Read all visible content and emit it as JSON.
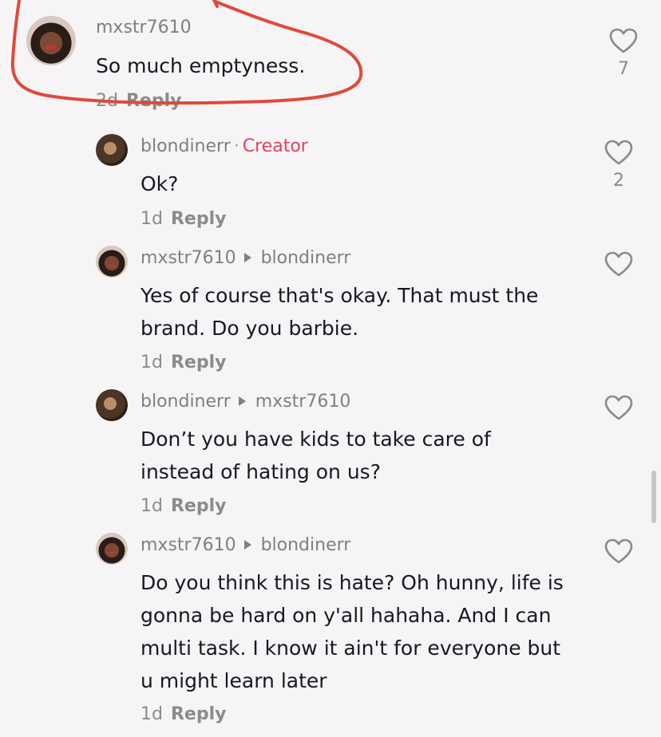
{
  "comments": [
    {
      "username": "mxstr7610",
      "text": "So much emptyness.",
      "age": "2d",
      "reply_label": "Reply",
      "likes": "7"
    },
    {
      "username": "blondinerr",
      "separator": "·",
      "badge": "Creator",
      "text": "Ok?",
      "age": "1d",
      "reply_label": "Reply",
      "likes": "2"
    },
    {
      "username": "mxstr7610",
      "reply_to": "blondinerr",
      "text_lines": [
        "Yes of course that's okay. That must the",
        "brand. Do you barbie."
      ],
      "age": "1d",
      "reply_label": "Reply"
    },
    {
      "username": "blondinerr",
      "reply_to": "mxstr7610",
      "text_lines": [
        "Don’t you have kids to take care of",
        "instead of hating on us?"
      ],
      "age": "1d",
      "reply_label": "Reply"
    },
    {
      "username": "mxstr7610",
      "reply_to": "blondinerr",
      "text_lines": [
        "Do you think this is hate? Oh hunny, life is",
        "gonna be hard on y'all hahaha. And I can",
        "multi task. I know it ain't for everyone but",
        "u might learn later"
      ],
      "age": "1d",
      "reply_label": "Reply"
    }
  ],
  "icons": {
    "like": "heart-outline-icon",
    "reply_arrow": "triangle-right-icon"
  },
  "colors": {
    "creator": "#e4405f",
    "annotation": "#e0493a",
    "background": "#f7f4f5"
  }
}
